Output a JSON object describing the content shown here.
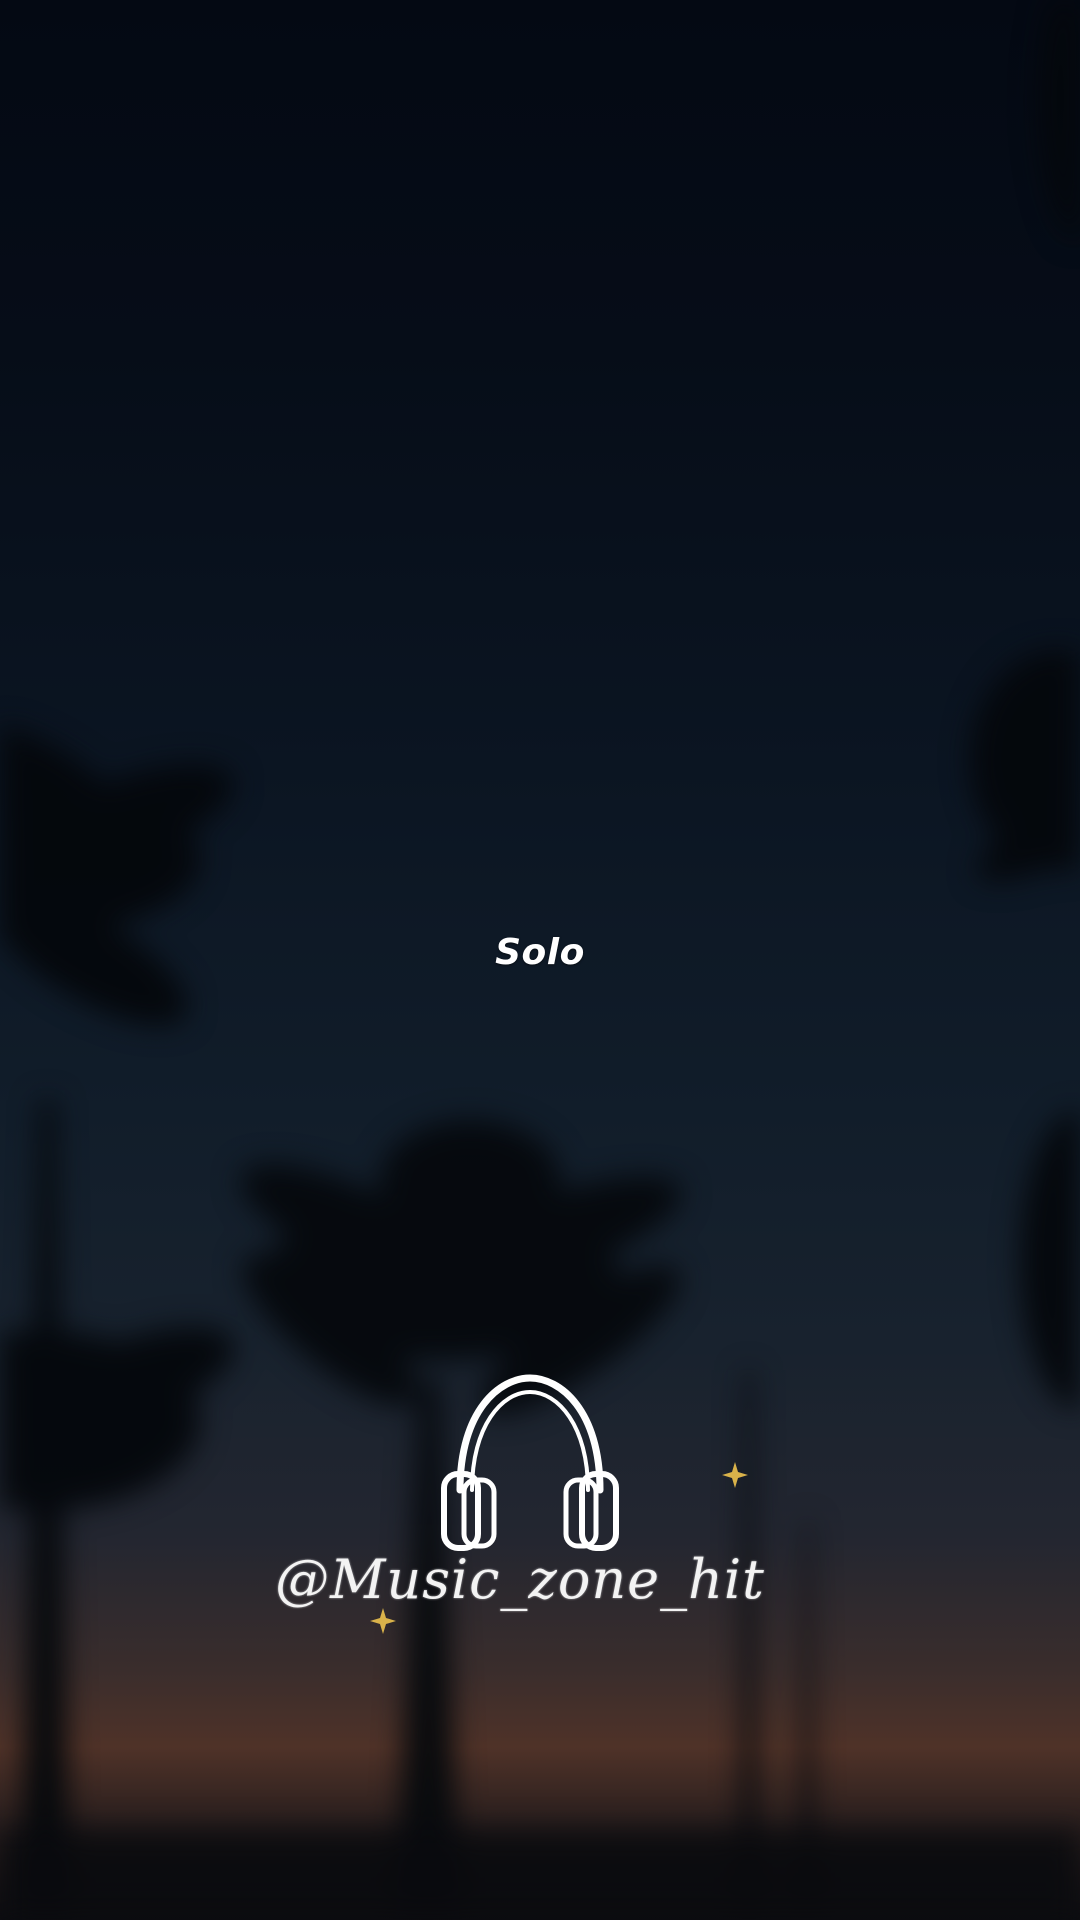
{
  "lyric": {
    "text": "Solo"
  },
  "watermark": {
    "handle": "@Music_zone_hit",
    "icon": "headphones-icon",
    "accent_color": "#d9b24a"
  },
  "background": {
    "scene": "palm-tree-silhouettes-at-dusk",
    "sky_color": "#0b1522",
    "horizon_color": "#4f3228"
  }
}
